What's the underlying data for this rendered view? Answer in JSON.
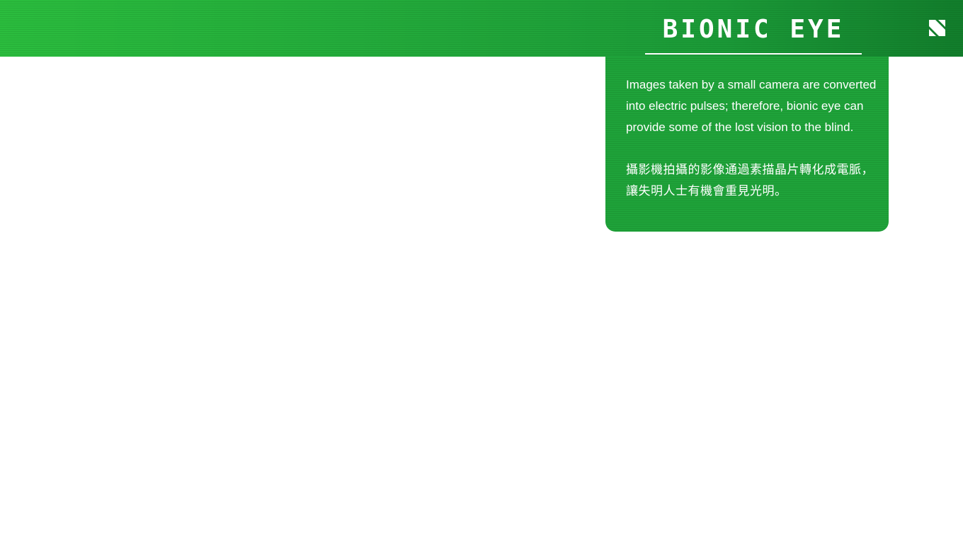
{
  "header": {
    "title": "BIONIC EYE",
    "logo_icon": "n-logo-icon"
  },
  "panel": {
    "description_en": "Images taken by a small camera are converted into electric pulses; therefore, bionic eye can provide some of the lost vision to the blind.",
    "description_zh": "攝影機拍攝的影像通過素描晶片轉化成電脈，讓失明人士有機會重見光明。"
  },
  "colors": {
    "accent_green": "#1fa33a",
    "gradient_start": "#2bbd3e",
    "gradient_end": "#127d2c",
    "text": "#ffffff",
    "background": "#ffffff"
  }
}
